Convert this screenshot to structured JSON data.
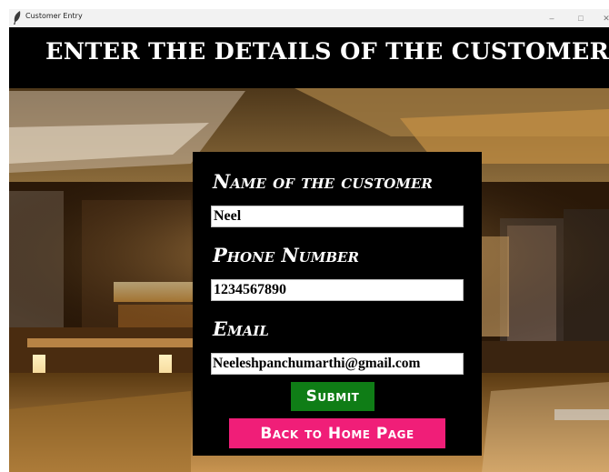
{
  "window": {
    "title": "Customer Entry",
    "controls": {
      "minimize": "–",
      "maximize": "□",
      "close": "✕"
    }
  },
  "banner": {
    "title": "ENTER THE DETAILS OF THE CUSTOMER"
  },
  "form": {
    "name_label": "Name of the customer",
    "name_value": "Neel",
    "phone_label": "Phone Number",
    "phone_value": "1234567890",
    "email_label": "Email",
    "email_value": "Neeleshpanchumarthi@gmail.com",
    "submit_label": "Submit",
    "back_label": "Back to Home Page"
  },
  "colors": {
    "submit_bg": "#0f7d16",
    "back_bg": "#f01e78",
    "panel_bg": "#000000",
    "banner_bg": "#000000"
  },
  "icons": {
    "app_icon": "feather-icon"
  }
}
